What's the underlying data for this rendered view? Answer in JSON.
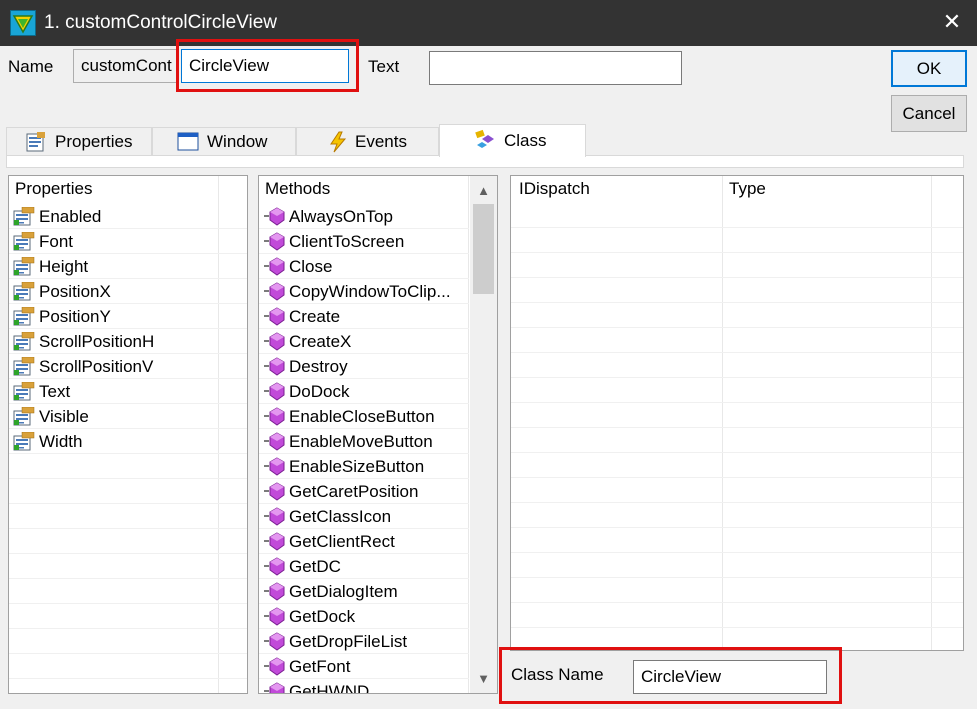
{
  "window": {
    "title": "1. customControlCircleView",
    "close_glyph": "✕",
    "title_icon": "app-icon"
  },
  "name_row": {
    "name_label": "Name",
    "name_prefix": "customCont",
    "name_value": "CircleView",
    "text_label": "Text",
    "text_value": ""
  },
  "buttons": {
    "ok": "OK",
    "cancel": "Cancel"
  },
  "tabs": [
    {
      "label": "Properties",
      "icon": "properties-icon",
      "active": false
    },
    {
      "label": "Window",
      "icon": "window-icon",
      "active": false
    },
    {
      "label": "Events",
      "icon": "lightning-icon",
      "active": false
    },
    {
      "label": "Class",
      "icon": "class-icon",
      "active": true
    }
  ],
  "properties_list": {
    "header": "Properties",
    "items": [
      "Enabled",
      "Font",
      "Height",
      "PositionX",
      "PositionY",
      "ScrollPositionH",
      "ScrollPositionV",
      "Text",
      "Visible",
      "Width"
    ]
  },
  "methods_list": {
    "header": "Methods",
    "items": [
      "AlwaysOnTop",
      "ClientToScreen",
      "Close",
      "CopyWindowToClip...",
      "Create",
      "CreateX",
      "Destroy",
      "DoDock",
      "EnableCloseButton",
      "EnableMoveButton",
      "EnableSizeButton",
      "GetCaretPosition",
      "GetClassIcon",
      "GetClientRect",
      "GetDC",
      "GetDialogItem",
      "GetDock",
      "GetDropFileList",
      "GetFont",
      "GetHWND"
    ]
  },
  "interface_table": {
    "columns": [
      "IDispatch",
      "Type"
    ]
  },
  "class_name": {
    "label": "Class Name",
    "value": "CircleView"
  },
  "colors": {
    "highlight_box": "#e01010",
    "titlebar": "#333333",
    "focus_border": "#0078d7"
  }
}
